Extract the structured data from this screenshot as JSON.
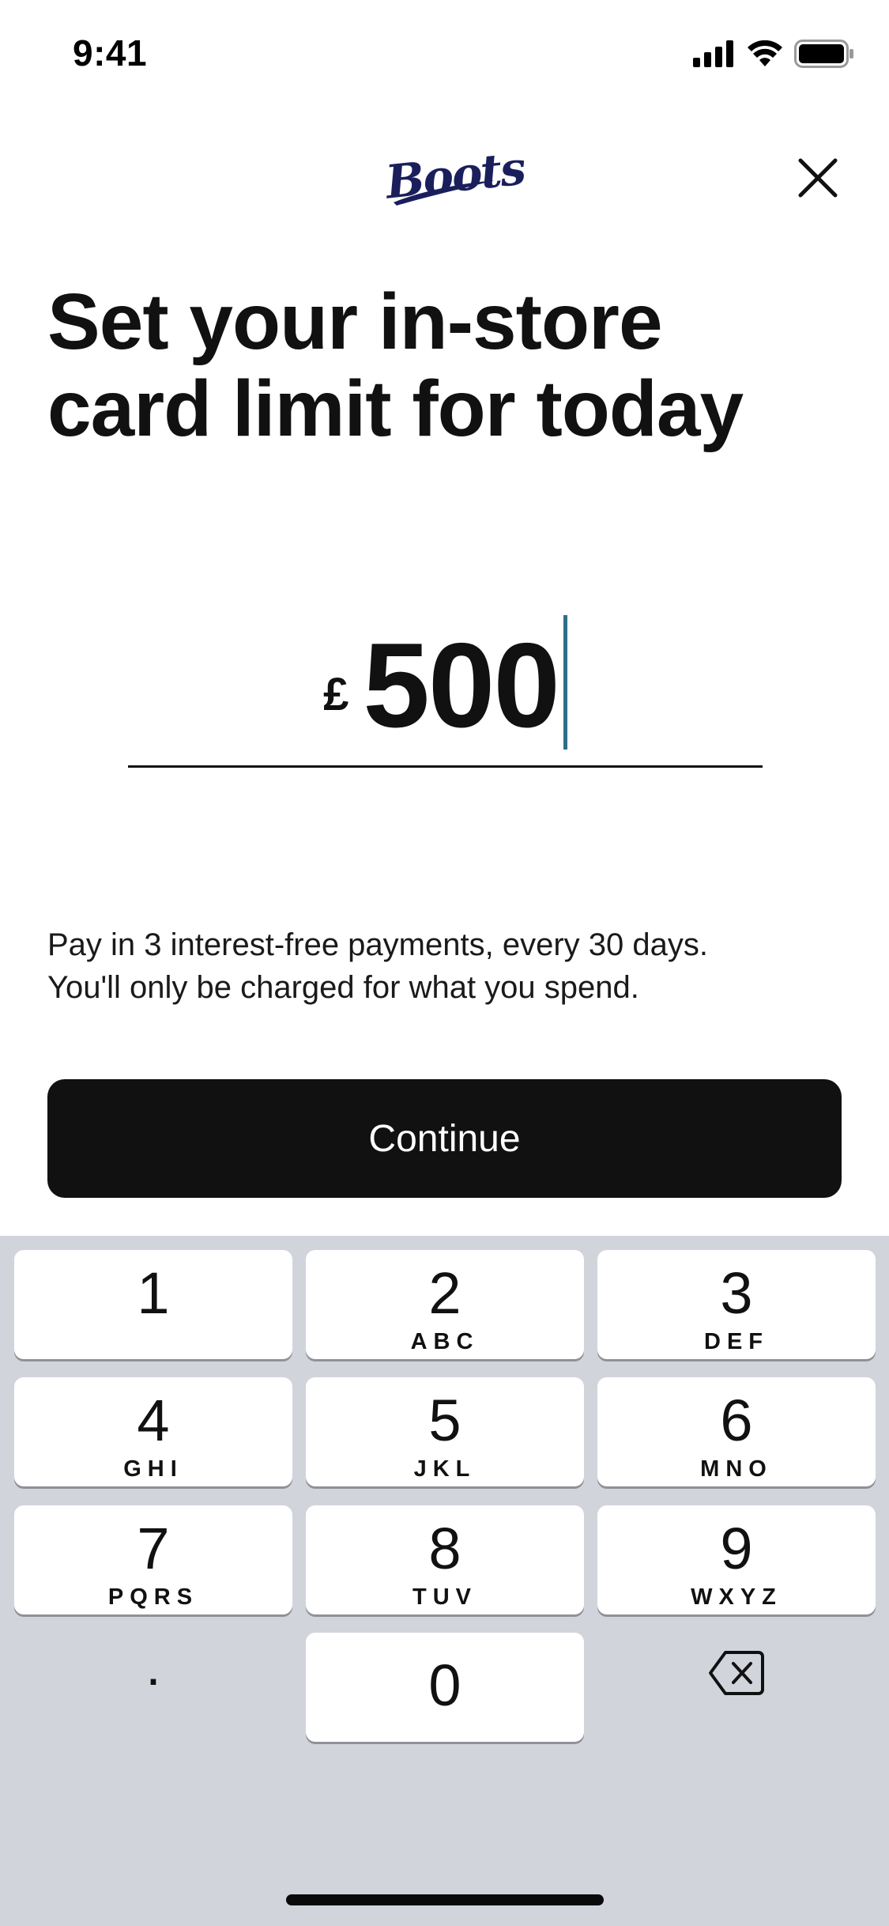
{
  "status_bar": {
    "time": "9:41",
    "icons": [
      "cellular-signal-icon",
      "wifi-icon",
      "battery-icon"
    ]
  },
  "header": {
    "logo_text": "Boots",
    "close_icon": "close-icon"
  },
  "title": {
    "line1": "Set your in-store",
    "line2": "card limit for today"
  },
  "amount": {
    "currency": "£",
    "value": "500"
  },
  "info": {
    "line1": "Pay in 3 interest-free payments, every 30 days.",
    "line2": "You'll only be charged for what you spend."
  },
  "continue_button": {
    "label": "Continue"
  },
  "keypad": {
    "keys": [
      {
        "digit": "1",
        "letters": ""
      },
      {
        "digit": "2",
        "letters": "ABC"
      },
      {
        "digit": "3",
        "letters": "DEF"
      },
      {
        "digit": "4",
        "letters": "GHI"
      },
      {
        "digit": "5",
        "letters": "JKL"
      },
      {
        "digit": "6",
        "letters": "MNO"
      },
      {
        "digit": "7",
        "letters": "PQRS"
      },
      {
        "digit": "8",
        "letters": "TUV"
      },
      {
        "digit": "9",
        "letters": "WXYZ"
      },
      {
        "digit": "0",
        "letters": ""
      }
    ],
    "decimal": ".",
    "backspace_icon": "backspace-icon"
  },
  "colors": {
    "button_background": "#111111",
    "caret": "#2d6f8a",
    "logo": "#1a1f5c",
    "keypad_background": "#d1d4db"
  }
}
